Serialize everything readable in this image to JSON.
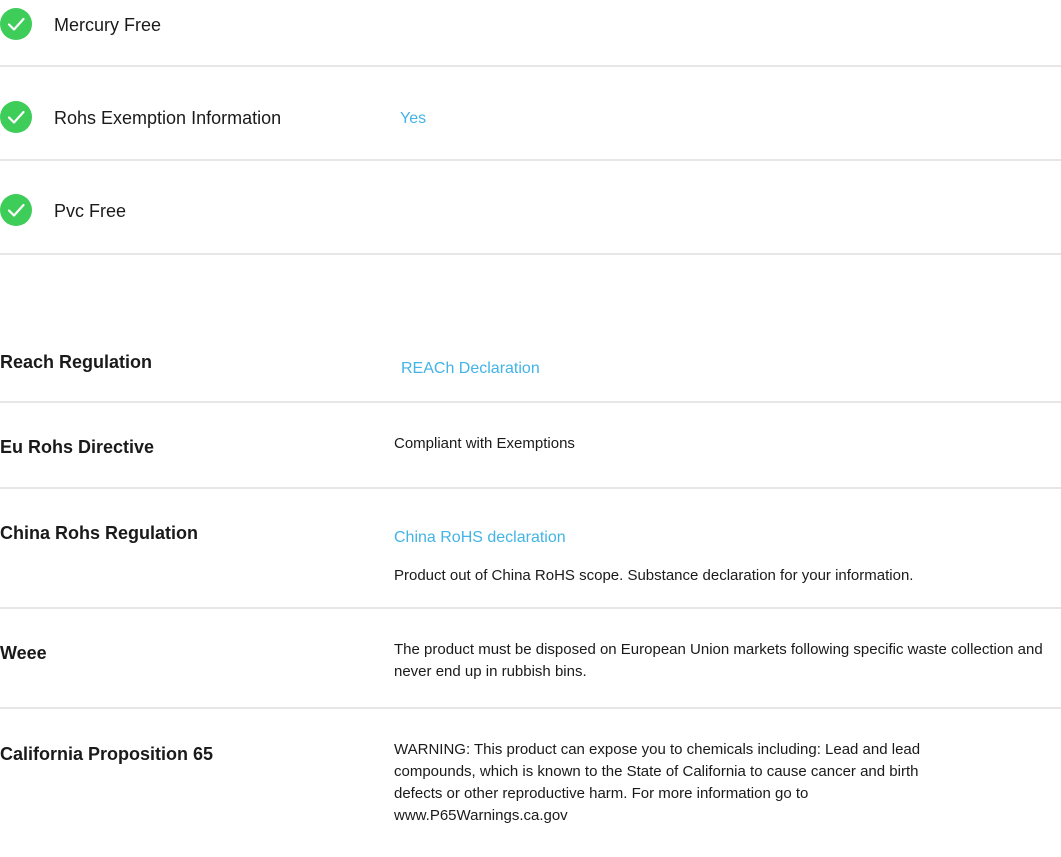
{
  "environmental_attributes": [
    {
      "label": "Mercury Free",
      "value": "",
      "icon": "check-circle-icon"
    },
    {
      "label": "Rohs Exemption Information",
      "value": "Yes",
      "icon": "check-circle-icon"
    },
    {
      "label": "Pvc Free",
      "value": "",
      "icon": "check-circle-icon"
    }
  ],
  "regulations": {
    "reach": {
      "label": "Reach Regulation",
      "link": "REACh Declaration"
    },
    "eu_rohs": {
      "label": "Eu Rohs Directive",
      "text": "Compliant with Exemptions"
    },
    "china_rohs": {
      "label": "China Rohs Regulation",
      "link": "China RoHS declaration",
      "text": "Product out of China RoHS scope. Substance declaration for your information."
    },
    "weee": {
      "label": "Weee",
      "text": "The product must be disposed on European Union markets following specific waste collection and never end up in rubbish bins."
    },
    "prop65": {
      "label": "California Proposition 65",
      "text": "WARNING: This product can expose you to chemicals including: Lead and lead compounds, which is known to the State of California to cause cancer and birth defects or other reproductive harm. For more information go to www.P65Warnings.ca.gov"
    }
  },
  "colors": {
    "check_green": "#3dcd58",
    "link_blue": "#42b4e6",
    "divider": "#e6e6e6",
    "text": "#1a1a1a"
  }
}
